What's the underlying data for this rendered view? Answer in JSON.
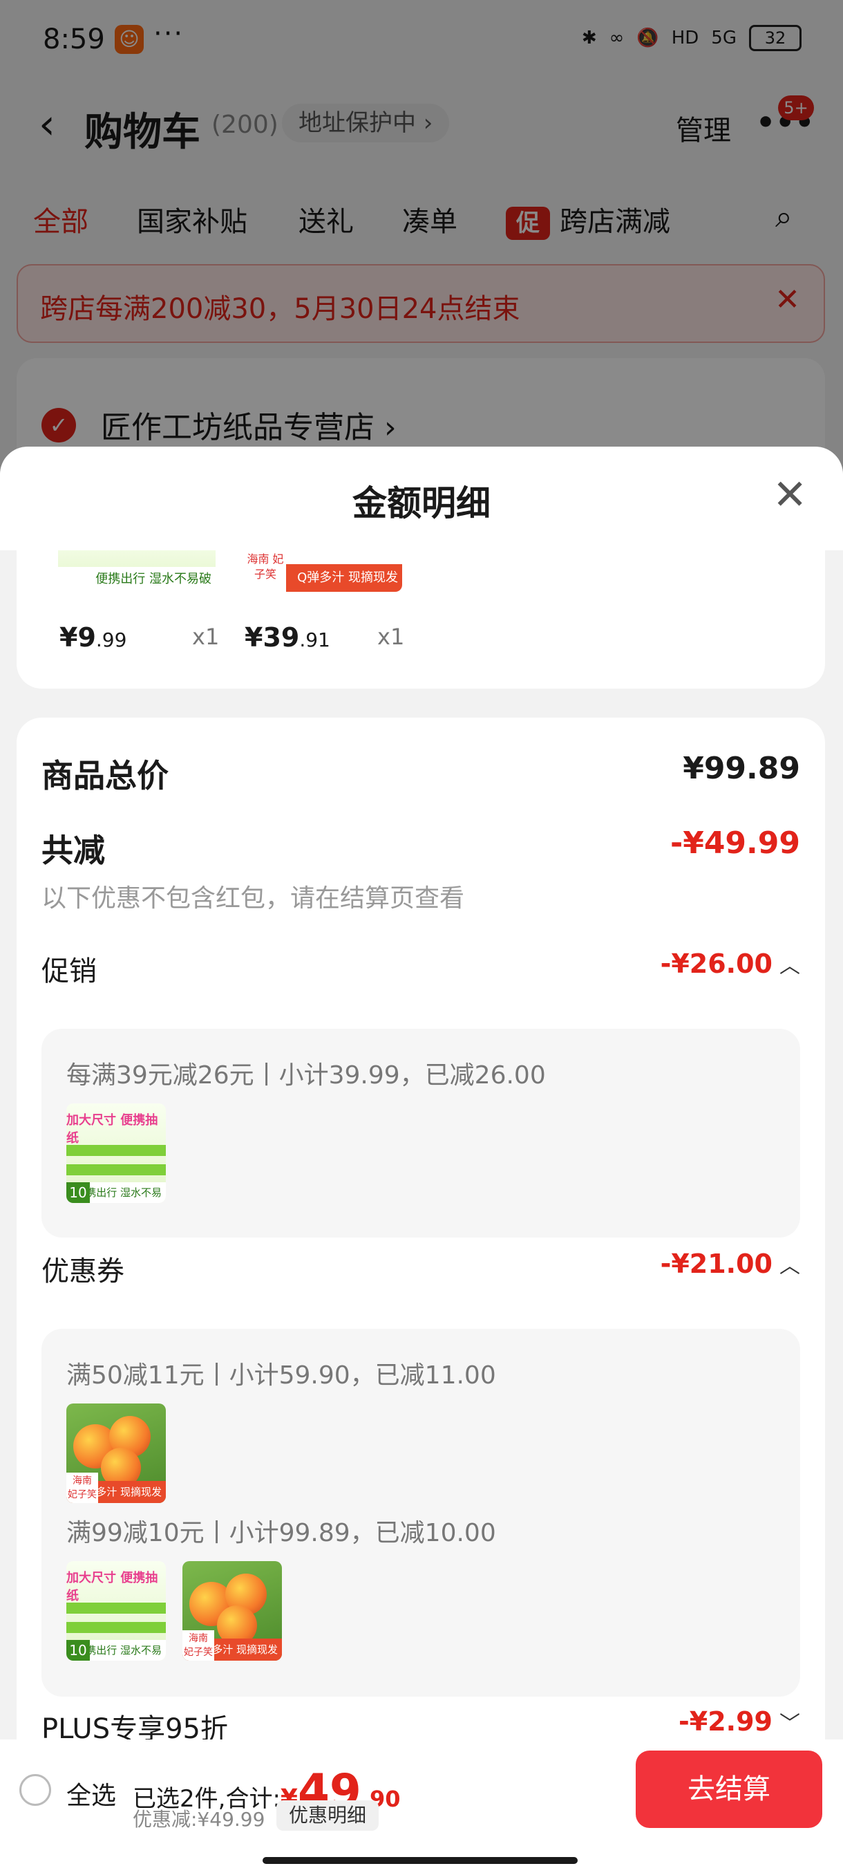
{
  "status_bar": {
    "time": "8:59",
    "dots": "···",
    "network_label": "HD",
    "signal_label": "5G",
    "battery": "32"
  },
  "header": {
    "back_icon": "chevron-left-icon",
    "title": "购物车",
    "count": "(200)",
    "address": "地址保护中 ›",
    "manage": "管理",
    "message_badge": "5+"
  },
  "tabs": [
    {
      "label": "全部",
      "active": true
    },
    {
      "label": "国家补贴"
    },
    {
      "label": "送礼"
    },
    {
      "label": "凑单"
    },
    {
      "label": "跨店满减",
      "tag": "促"
    }
  ],
  "banner": {
    "text": "跨店每满200减30，5月30日24点结束"
  },
  "store": {
    "name": "匠作工坊纸品专营店 ›"
  },
  "sheet": {
    "title": "金额明细",
    "thumb_items": [
      {
        "price_main": "¥9",
        "price_dec": ".99",
        "qty": "x1",
        "image": "tissue",
        "label": "便携出行 湿水不易破"
      },
      {
        "price_main": "¥39",
        "price_dec": ".91",
        "qty": "x1",
        "image": "peach",
        "label": "Q弹多汁 现摘现发"
      }
    ],
    "total": {
      "label": "商品总价",
      "value": "¥99.89"
    },
    "reduce": {
      "label": "共减",
      "value": "-¥49.99",
      "note": "以下优惠不包含红包，请在结算页查看"
    },
    "promotion": {
      "label": "促销",
      "value": "-¥26.00",
      "rules": [
        {
          "text": "每满39元减26元丨小计39.99，已减26.00",
          "images": [
            "tissue"
          ]
        }
      ]
    },
    "coupon": {
      "label": "优惠券",
      "value": "-¥21.00",
      "rules": [
        {
          "text": "满50减11元丨小计59.90，已减11.00",
          "images": [
            "peach"
          ]
        },
        {
          "text": "满99减10元丨小计99.89，已减10.00",
          "images": [
            "tissue",
            "peach"
          ]
        }
      ]
    },
    "plus": {
      "label": "PLUS专享95折",
      "value": "-¥2.99"
    }
  },
  "product_labels": {
    "tissue_title": "加大尺寸 便携抽纸",
    "tissue_band": "便携出行 湿水不易破",
    "tissue_count": "10",
    "peach_origin": "海南 妃子笑",
    "peach_band": "Q弹多汁 现摘现发"
  },
  "bottom": {
    "select_all": "全选",
    "selected_text": "已选2件,合计:",
    "currency": "¥",
    "total_int": "49",
    "total_dec": ".90",
    "saved": "优惠减:¥49.99",
    "detail_btn": "优惠明细",
    "checkout": "去结算"
  },
  "colors": {
    "accent": "#e2231a",
    "checkout_bg": "#f2333b"
  }
}
